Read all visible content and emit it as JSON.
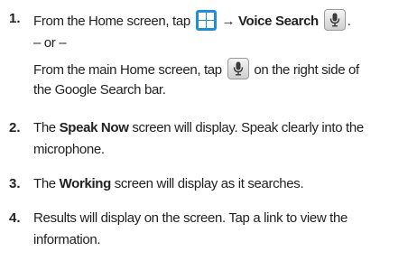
{
  "steps": [
    {
      "number": "1.",
      "line1_a": "From the Home screen, tap",
      "arrow": "→",
      "voice_search": "Voice Search",
      "line1_end": ".",
      "or": "– or –",
      "line3_a": "From the main Home screen, tap",
      "line3_b": "on the right side of",
      "line4": "the Google Search bar."
    },
    {
      "number": "2.",
      "line1_a": "The",
      "bold": "Speak Now",
      "line1_b": "screen will display. Speak clearly into the",
      "line2": "microphone."
    },
    {
      "number": "3.",
      "line1_a": "The",
      "bold": "Working",
      "line1_b": "screen will display as it searches."
    },
    {
      "number": "4.",
      "line1": "Results will display on the screen. Tap a link to view the",
      "line2": "information."
    }
  ],
  "icons": {
    "apps": "apps-grid-icon",
    "mic": "microphone-icon",
    "apps_color": "#1e8fd6"
  }
}
